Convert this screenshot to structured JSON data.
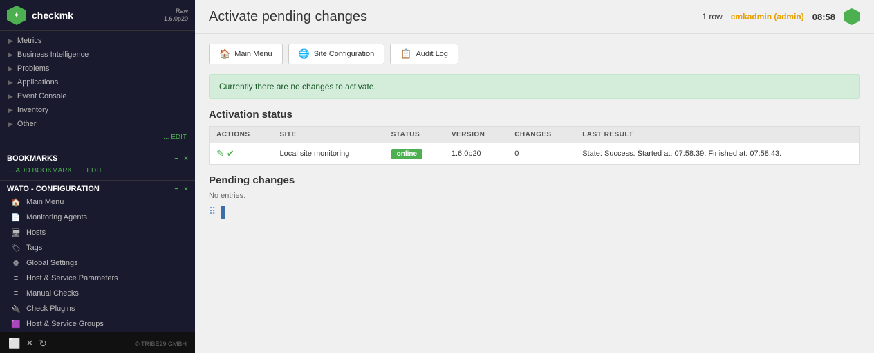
{
  "sidebar": {
    "logo_text": "checkmk",
    "logo_version": "Raw\n1.6.0p20",
    "nav_items": [
      {
        "label": "Metrics",
        "arrow": "▶"
      },
      {
        "label": "Business Intelligence",
        "arrow": "▶"
      },
      {
        "label": "Problems",
        "arrow": "▶"
      },
      {
        "label": "Applications",
        "arrow": "▶"
      },
      {
        "label": "Event Console",
        "arrow": "▶"
      },
      {
        "label": "Inventory",
        "arrow": "▶"
      },
      {
        "label": "Other",
        "arrow": "▶"
      }
    ],
    "edit_label": "... EDIT",
    "bookmarks_title": "BOOKMARKS",
    "bookmarks_minus": "−",
    "bookmarks_x": "×",
    "add_bookmark_label": "... ADD BOOKMARK",
    "bookmarks_edit_label": "... EDIT",
    "wato_title": "WATO - CONFIGURATION",
    "wato_minus": "−",
    "wato_x": "×",
    "wato_items": [
      {
        "label": "Main Menu",
        "icon": "🏠"
      },
      {
        "label": "Monitoring Agents",
        "icon": "📄"
      },
      {
        "label": "Hosts",
        "icon": "🖥"
      },
      {
        "label": "Tags",
        "icon": "🏷"
      },
      {
        "label": "Global Settings",
        "icon": "⚙"
      },
      {
        "label": "Host & Service Parameters",
        "icon": "≡"
      },
      {
        "label": "Manual Checks",
        "icon": "≡"
      },
      {
        "label": "Check Plugins",
        "icon": "🔌"
      },
      {
        "label": "Host & Service Groups",
        "icon": "🟪"
      }
    ],
    "footer_copy": "© TRIBE29 GMBH"
  },
  "topbar": {
    "page_title": "Activate pending changes",
    "row_count": "1 row",
    "admin_label": "cmkadmin (admin)",
    "time": "08:58"
  },
  "buttons": [
    {
      "label": "Main Menu",
      "icon": "🏠"
    },
    {
      "label": "Site Configuration",
      "icon": "🌐"
    },
    {
      "label": "Audit Log",
      "icon": "📋"
    }
  ],
  "info_banner": {
    "message": "Currently there are no changes to activate."
  },
  "activation_status": {
    "title": "Activation status",
    "columns": [
      "ACTIONS",
      "SITE",
      "STATUS",
      "VERSION",
      "CHANGES",
      "LAST RESULT"
    ],
    "rows": [
      {
        "actions": "✎ ✔",
        "site": "Local site monitoring",
        "status": "online",
        "version": "1.6.0p20",
        "changes": "0",
        "last_result": "State: Success. Started at: 07:58:39. Finished at: 07:58:43."
      }
    ]
  },
  "pending_changes": {
    "title": "Pending changes",
    "no_entries": "No entries."
  }
}
